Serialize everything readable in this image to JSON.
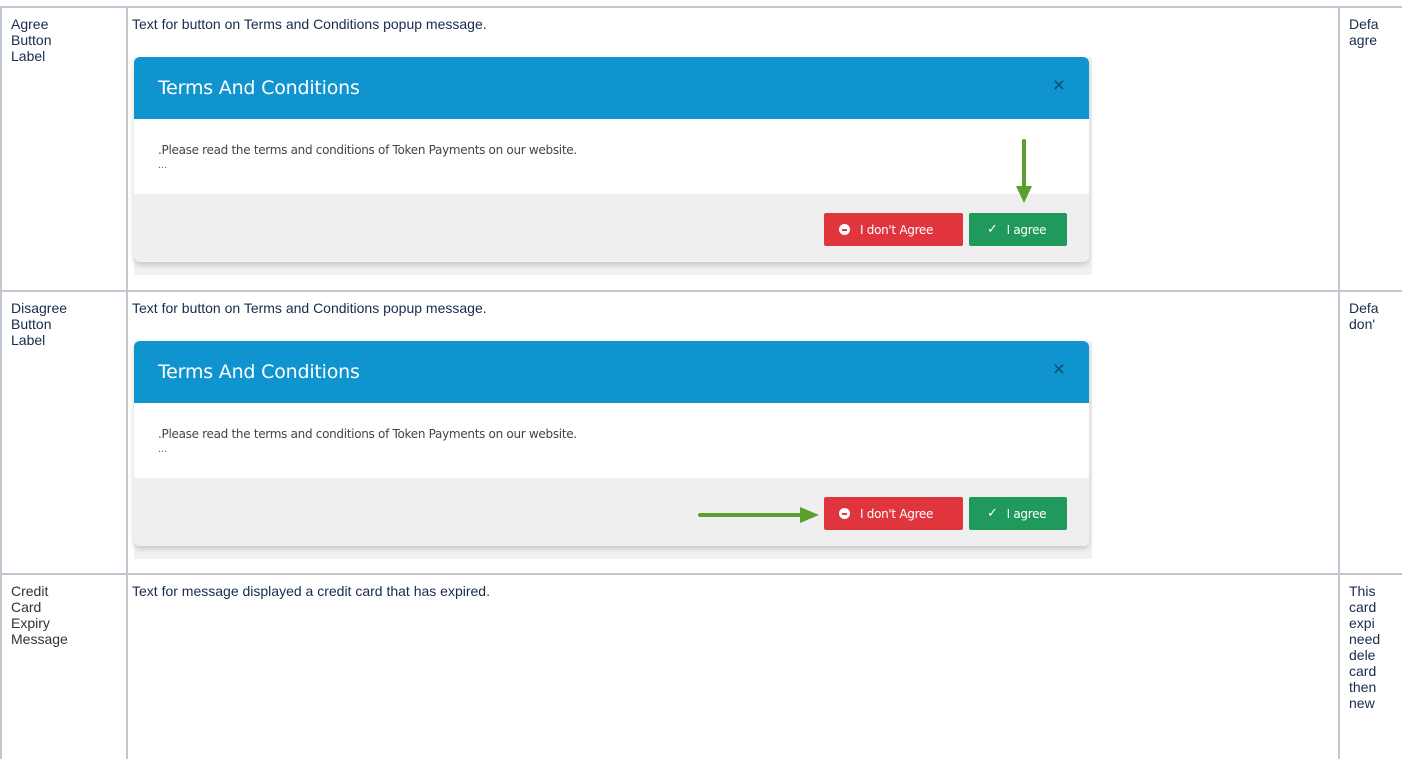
{
  "rows": [
    {
      "label": "Agree Button Label",
      "description": "Text for button on Terms and Conditions popup message.",
      "default": "Defa\nagre"
    },
    {
      "label": "Disagree Button Label",
      "description": "Text for button on Terms and Conditions popup message.",
      "default": "Defa\ndon'"
    },
    {
      "label": "Credit Card Expiry Message",
      "description": "Text for message displayed a credit card that has expired.",
      "default": "This\ncard\nexpi\nneed\ndele\ncard\nthen\nnew"
    }
  ],
  "modal": {
    "title": "Terms And Conditions",
    "close_glyph": "×",
    "body_text": ".Please read the terms and conditions of Token Payments on our website.",
    "body_ellipsis": "...",
    "disagree_label": "I don't Agree",
    "agree_label": "I agree",
    "check_glyph": "✓"
  },
  "colors": {
    "header": "#0f94cf",
    "disagree": "#e1353d",
    "agree": "#1f9a5c",
    "arrow": "#5aa02c"
  },
  "icons": [
    "close-icon",
    "minus-circle-icon",
    "check-icon",
    "arrow-down-icon",
    "arrow-right-icon"
  ]
}
